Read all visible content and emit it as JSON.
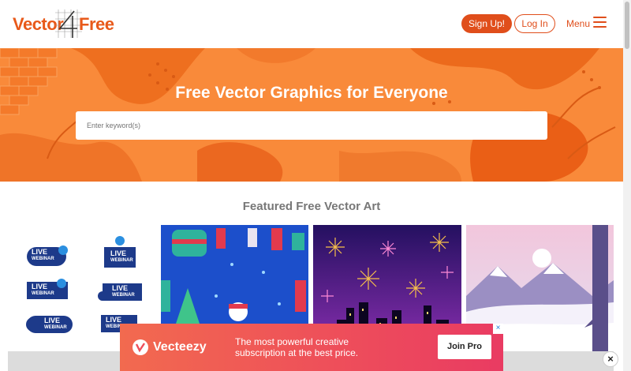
{
  "header": {
    "logo_left": "Vector",
    "logo_right": "Free",
    "signup_label": "Sign Up!",
    "login_label": "Log In",
    "menu_label": "Menu"
  },
  "hero": {
    "title": "Free Vector Graphics for Everyone",
    "search_placeholder": "Enter keyword(s)"
  },
  "featured": {
    "title": "Featured Free Vector Art",
    "webinar_badges": [
      {
        "line1": "LIVE",
        "line2": "WEBINAR"
      },
      {
        "line1": "LIVE",
        "line2": "WEBINAR"
      },
      {
        "line1": "LIVE",
        "line2": "WEBINAR"
      },
      {
        "line1": "LIVE",
        "line2": "WEBINAR"
      },
      {
        "line1": "LIVE",
        "line2": "WEBINAR"
      },
      {
        "line1": "LIVE",
        "line2": "WEBINAR"
      }
    ]
  },
  "ad": {
    "brand": "Vecteezy",
    "text": "The most powerful creative subscription at the best price.",
    "button_label": "Join Pro",
    "close_glyph": "×"
  },
  "float_close_glyph": "×",
  "colors": {
    "brand_orange": "#e04e1b",
    "hero_orange": "#f98a3a",
    "ad_gradient_start": "#f26a4f",
    "ad_gradient_end": "#e93b62"
  },
  "icons": [
    "menu-icon",
    "close-icon",
    "vecteezy-logo-icon"
  ]
}
